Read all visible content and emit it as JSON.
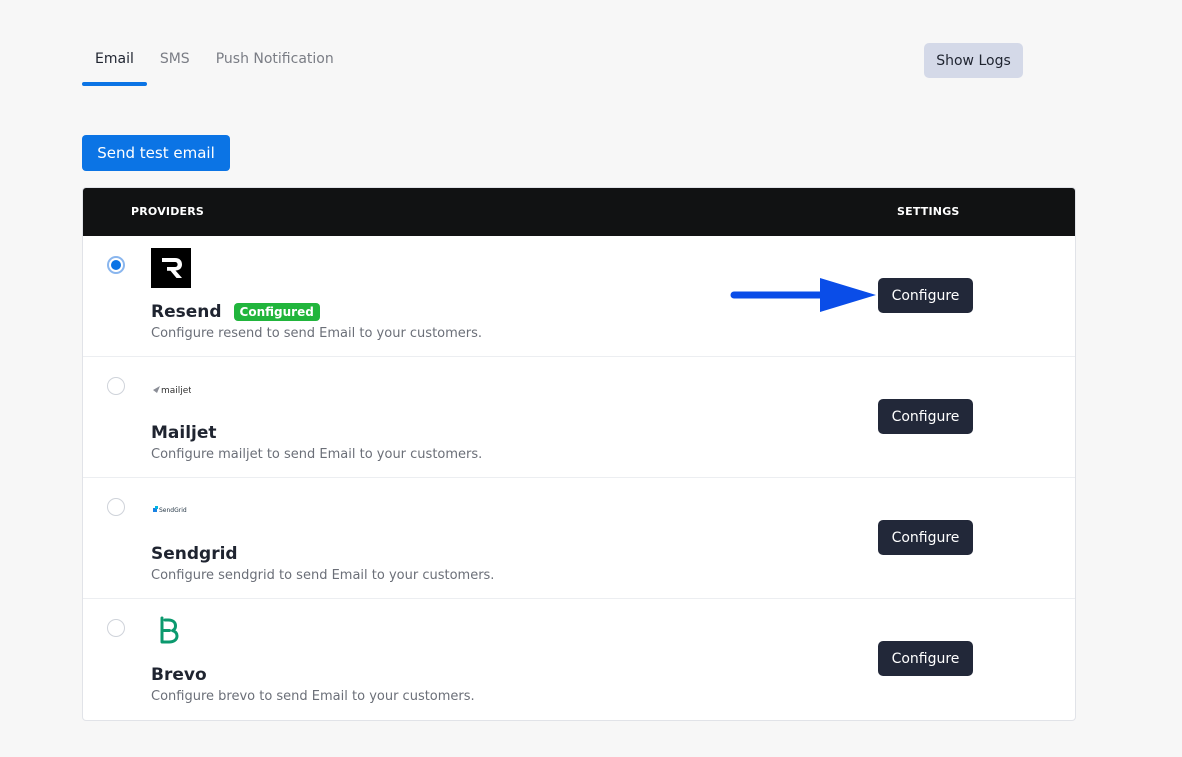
{
  "tabs": [
    {
      "label": "Email",
      "active": true
    },
    {
      "label": "SMS",
      "active": false
    },
    {
      "label": "Push Notification",
      "active": false
    }
  ],
  "show_logs_label": "Show Logs",
  "send_test_label": "Send test email",
  "table": {
    "header_providers": "PROVIDERS",
    "header_settings": "SETTINGS",
    "configure_label": "Configure",
    "rows": [
      {
        "name": "Resend",
        "badge": "Configured",
        "description": "Configure resend to send Email to your customers.",
        "selected": true,
        "logo": "resend-logo"
      },
      {
        "name": "Mailjet",
        "description": "Configure mailjet to send Email to your customers.",
        "selected": false,
        "logo": "mailjet-logo",
        "logo_text": "mailjet"
      },
      {
        "name": "Sendgrid",
        "description": "Configure sendgrid to send Email to your customers.",
        "selected": false,
        "logo": "sendgrid-logo",
        "logo_text": "SendGrid"
      },
      {
        "name": "Brevo",
        "description": "Configure brevo to send Email to your customers.",
        "selected": false,
        "logo": "brevo-logo"
      }
    ]
  },
  "colors": {
    "accent": "#0b74e5",
    "header_bg": "#111213",
    "configure_bg": "#222839",
    "badge_green": "#21b53c",
    "arrow_blue": "#0a4de8"
  }
}
